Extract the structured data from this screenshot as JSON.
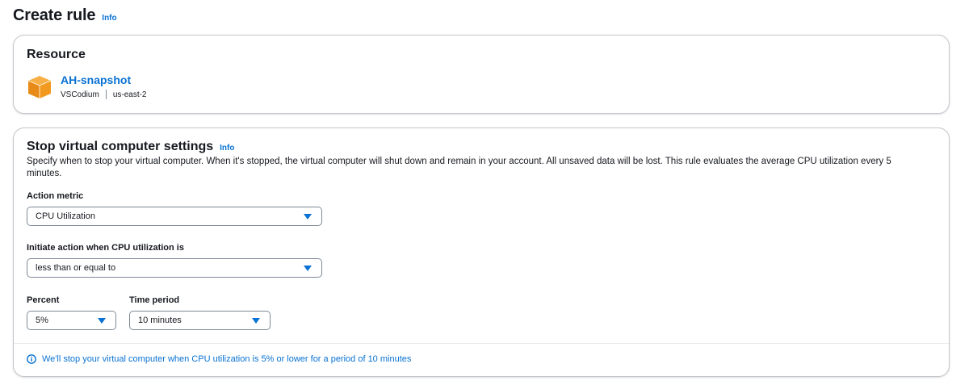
{
  "header": {
    "title": "Create rule",
    "info": "Info"
  },
  "resource": {
    "heading": "Resource",
    "name": "AH-snapshot",
    "blueprint": "VSCodium",
    "region": "us-east-2",
    "icon": "cube-icon"
  },
  "settings": {
    "heading": "Stop virtual computer settings",
    "info": "Info",
    "description": "Specify when to stop your virtual computer. When it's stopped, the virtual computer will shut down and remain in your account. All unsaved data will be lost. This rule evaluates the average CPU utilization every 5 minutes.",
    "action_metric": {
      "label": "Action metric",
      "value": "CPU Utilization"
    },
    "condition": {
      "label": "Initiate action when CPU utilization is",
      "value": "less than or equal to"
    },
    "percent": {
      "label": "Percent",
      "value": "5%"
    },
    "time_period": {
      "label": "Time period",
      "value": "10 minutes"
    },
    "summary": "We'll stop your virtual computer when CPU utilization is 5% or lower for a period of 10 minutes"
  },
  "colors": {
    "link": "#0972d3",
    "border": "#c6c6cd",
    "cube_orange": "#f29a1f"
  }
}
